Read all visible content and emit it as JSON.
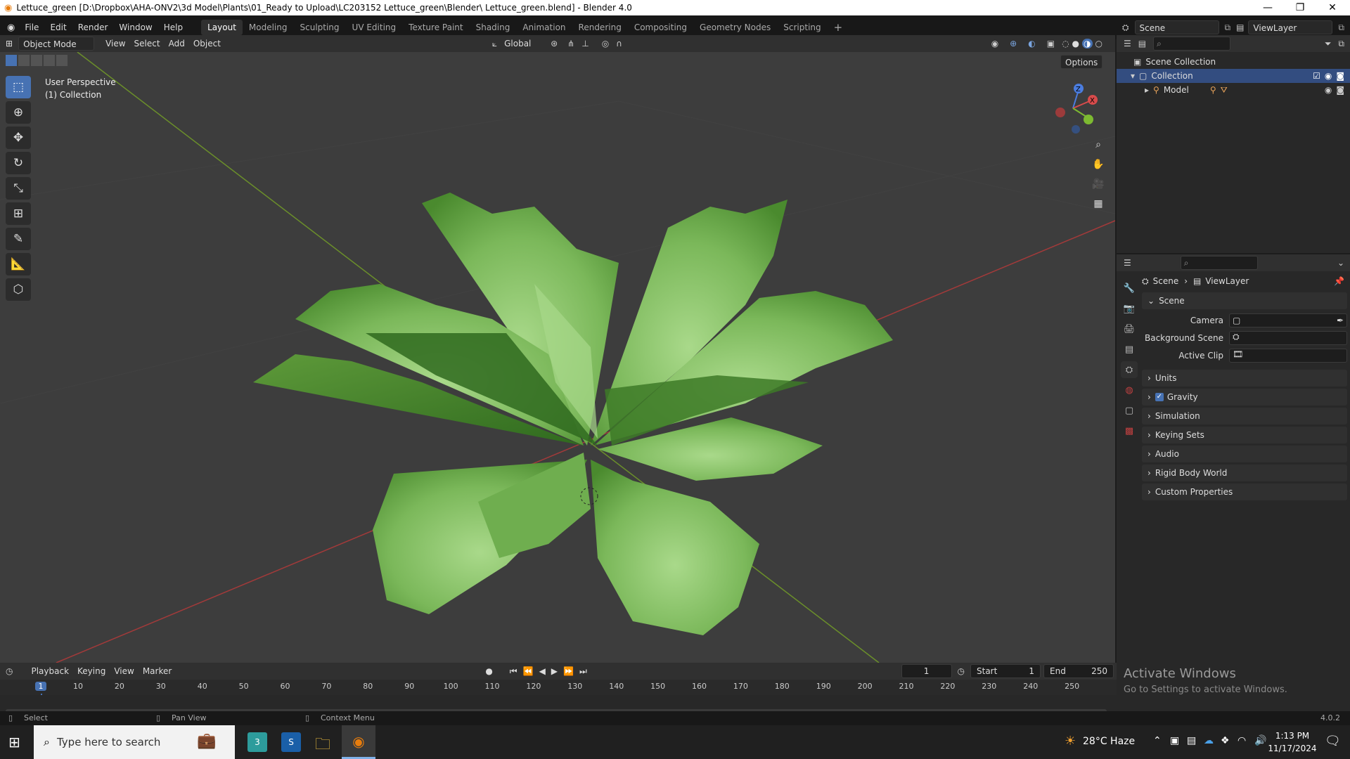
{
  "window": {
    "title": "Lettuce_green [D:\\Dropbox\\AHA-ONV2\\3d Model\\Plants\\01_Ready to Upload\\LC203152 Lettuce_green\\Blender\\ Lettuce_green.blend] - Blender 4.0"
  },
  "menu": [
    "File",
    "Edit",
    "Render",
    "Window",
    "Help"
  ],
  "workspaces": [
    "Layout",
    "Modeling",
    "Sculpting",
    "UV Editing",
    "Texture Paint",
    "Shading",
    "Animation",
    "Rendering",
    "Compositing",
    "Geometry Nodes",
    "Scripting"
  ],
  "active_workspace": "Layout",
  "scene_name": "Scene",
  "view_layer": "ViewLayer",
  "viewport": {
    "mode": "Object Mode",
    "menus": [
      "View",
      "Select",
      "Add",
      "Object"
    ],
    "orientation": "Global",
    "options": "Options",
    "overlay_line1": "User Perspective",
    "overlay_line2": "(1) Collection"
  },
  "outliner": {
    "root": "Scene Collection",
    "collection": "Collection",
    "object": "Model"
  },
  "properties": {
    "breadcrumb_scene": "Scene",
    "breadcrumb_layer": "ViewLayer",
    "section": "Scene",
    "fields": {
      "camera": "Camera",
      "background_scene": "Background Scene",
      "active_clip": "Active Clip"
    },
    "panels": [
      "Units",
      "Gravity",
      "Simulation",
      "Keying Sets",
      "Audio",
      "Rigid Body World",
      "Custom Properties"
    ],
    "gravity_checked": true
  },
  "timeline": {
    "menus": [
      "Playback",
      "Keying",
      "View",
      "Marker"
    ],
    "current_frame": "1",
    "start_label": "Start",
    "start": "1",
    "end_label": "End",
    "end": "250",
    "ticks": [
      "1",
      "10",
      "20",
      "30",
      "40",
      "50",
      "60",
      "70",
      "80",
      "90",
      "100",
      "110",
      "120",
      "130",
      "140",
      "150",
      "160",
      "170",
      "180",
      "190",
      "200",
      "210",
      "220",
      "230",
      "240",
      "250"
    ]
  },
  "statusbar": {
    "select": "Select",
    "pan": "Pan View",
    "context": "Context Menu",
    "version": "4.0.2"
  },
  "watermark": {
    "line1": "Activate Windows",
    "line2": "Go to Settings to activate Windows."
  },
  "taskbar": {
    "search_placeholder": "Type here to search",
    "weather": "28°C  Haze",
    "time": "1:13 PM",
    "date": "11/17/2024"
  },
  "colors": {
    "accent": "#4772b3",
    "x_axis": "#a33a3a",
    "y_axis": "#6b8f2a",
    "leaf_light": "#8dc46b",
    "leaf_dark": "#3f7a28"
  }
}
